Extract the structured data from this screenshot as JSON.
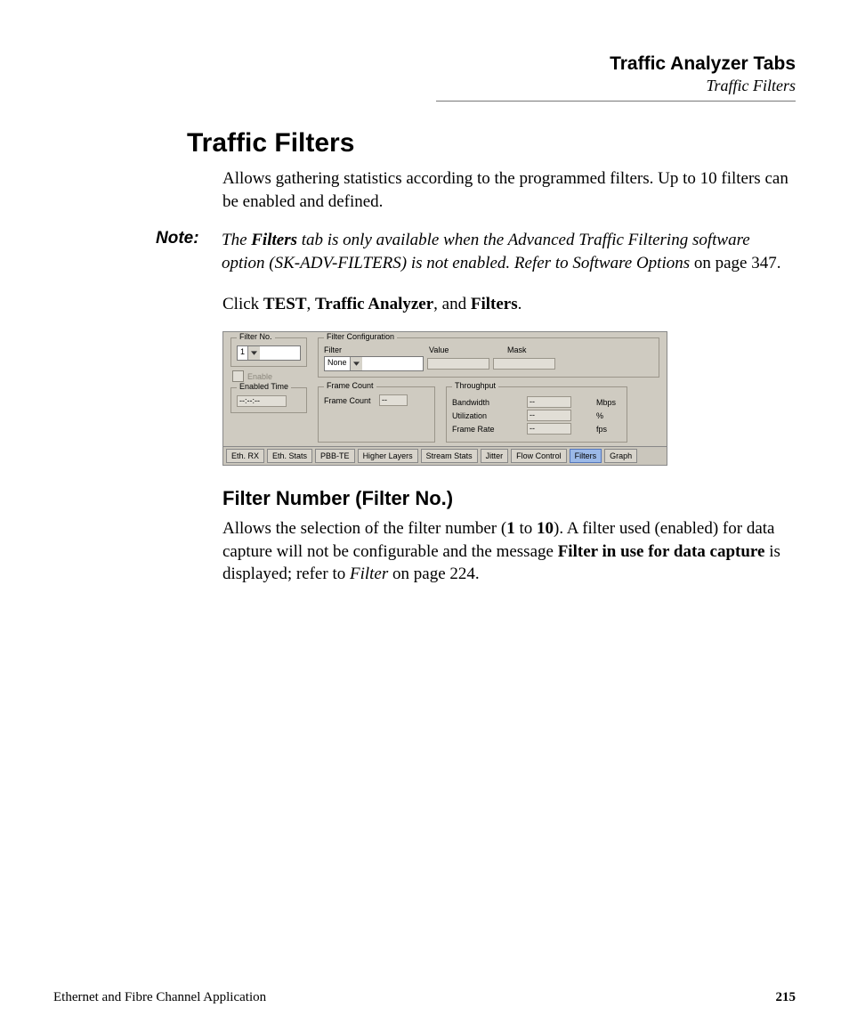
{
  "header": {
    "title": "Traffic Analyzer Tabs",
    "subtitle": "Traffic Filters"
  },
  "section": {
    "title": "Traffic Filters",
    "intro": "Allows gathering statistics according to the programmed filters. Up to 10 filters can be enabled and defined."
  },
  "note": {
    "label": "Note:",
    "pre": "The ",
    "filters_word": "Filters",
    "mid": " tab is only available when the Advanced Traffic Filtering software option (SK-ADV-FILTERS) is not enabled. Refer to Software Options",
    "post": " on page 347."
  },
  "click_line": {
    "pre": "Click ",
    "b1": "TEST",
    "sep1": ", ",
    "b2": "Traffic Analyzer",
    "sep2": ", and ",
    "b3": "Filters",
    "post": "."
  },
  "ui": {
    "filter_no": {
      "legend": "Filter No.",
      "value": "1"
    },
    "enable": {
      "label": "Enable"
    },
    "enabled_time": {
      "legend": "Enabled Time",
      "value": "--:--:--"
    },
    "config": {
      "legend": "Filter Configuration",
      "labels": {
        "filter": "Filter",
        "value": "Value",
        "mask": "Mask"
      },
      "filter_value": "None",
      "value_value": "",
      "mask_value": ""
    },
    "frame_count": {
      "legend": "Frame Count",
      "label": "Frame Count",
      "value": "--"
    },
    "throughput": {
      "legend": "Throughput",
      "rows": {
        "bandwidth": {
          "label": "Bandwidth",
          "value": "--",
          "unit": "Mbps"
        },
        "utilization": {
          "label": "Utilization",
          "value": "--",
          "unit": "%"
        },
        "frame_rate": {
          "label": "Frame Rate",
          "value": "--",
          "unit": "fps"
        }
      }
    },
    "tabs": {
      "eth_rx": "Eth. RX",
      "eth_stats": "Eth. Stats",
      "pbb_te": "PBB-TE",
      "higher_layers": "Higher Layers",
      "stream_stats": "Stream Stats",
      "jitter": "Jitter",
      "flow_control": "Flow Control",
      "filters": "Filters",
      "graph": "Graph"
    }
  },
  "filter_number": {
    "title": "Filter Number (Filter No.)",
    "p_pre": "Allows the selection of the filter number (",
    "p_b1": "1",
    "p_mid1": " to ",
    "p_b2": "10",
    "p_mid2": "). A filter used (enabled) for data capture will not be configurable and the message ",
    "p_b3": "Filter in use for data capture",
    "p_mid3": " is displayed; refer to ",
    "p_i1": "Filter",
    "p_post": " on page 224."
  },
  "footer": {
    "left": "Ethernet and Fibre Channel Application",
    "page": "215"
  }
}
